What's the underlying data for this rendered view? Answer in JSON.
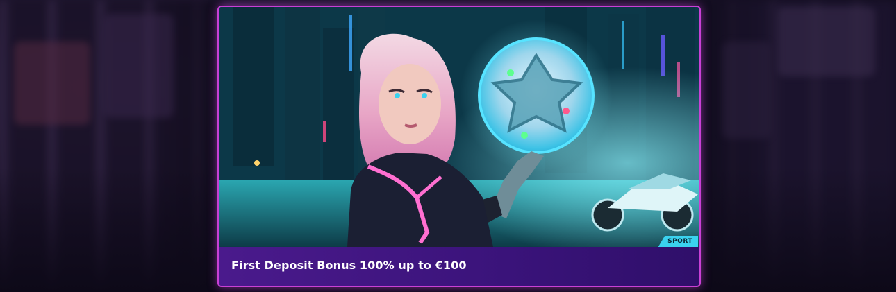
{
  "promo": {
    "title": "First Deposit Bonus 100% up to €100",
    "category_badge": "SPORT"
  },
  "colors": {
    "card_border": "#c940d6",
    "caption_bg": "#4a1a8c",
    "badge_bg": "#3ad2ef",
    "page_bg": "#0f0b1c"
  },
  "icons": {
    "hero_image": "cyberpunk-woman-holding-glowing-football-illustration"
  }
}
